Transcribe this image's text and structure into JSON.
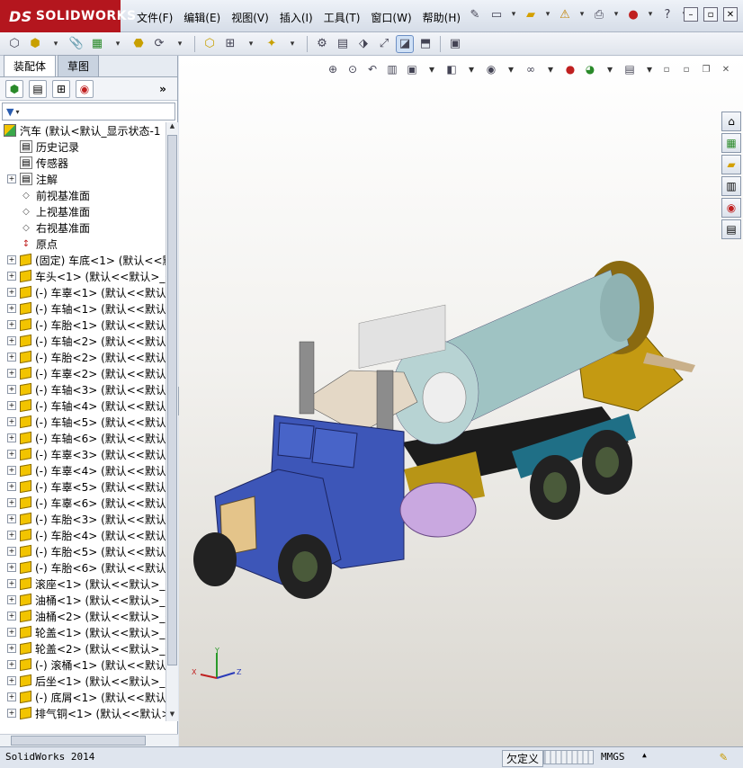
{
  "app": {
    "brand_prefix": "DS",
    "brand": "SOLIDWORKS"
  },
  "menu": [
    {
      "label": "文件(F)"
    },
    {
      "label": "编辑(E)"
    },
    {
      "label": "视图(V)"
    },
    {
      "label": "插入(I)"
    },
    {
      "label": "工具(T)"
    },
    {
      "label": "窗口(W)"
    },
    {
      "label": "帮助(H)"
    }
  ],
  "panel": {
    "tabs": [
      {
        "label": "装配体"
      },
      {
        "label": "草图"
      }
    ],
    "expand_symbol": "»"
  },
  "tree": {
    "root_label": "汽车  (默认<默认_显示状态-1",
    "items": [
      {
        "kind": "folder",
        "icon": "history-icon",
        "label": "历史记录",
        "expandable": false
      },
      {
        "kind": "folder",
        "icon": "sensor-icon",
        "label": "传感器",
        "expandable": false
      },
      {
        "kind": "folder",
        "icon": "annotation-icon",
        "label": "注解",
        "expandable": true
      },
      {
        "kind": "plane",
        "icon": "plane-icon",
        "label": "前视基准面",
        "expandable": false
      },
      {
        "kind": "plane",
        "icon": "plane-icon",
        "label": "上视基准面",
        "expandable": false
      },
      {
        "kind": "plane",
        "icon": "plane-icon",
        "label": "右视基准面",
        "expandable": false
      },
      {
        "kind": "origin",
        "icon": "origin-icon",
        "label": "原点",
        "expandable": false
      },
      {
        "kind": "part",
        "icon": "part-icon",
        "label": "(固定) 车底<1> (默认<<默",
        "expandable": true
      },
      {
        "kind": "part",
        "icon": "part-icon",
        "label": "车头<1> (默认<<默认>_外",
        "expandable": true
      },
      {
        "kind": "part",
        "icon": "part-icon",
        "label": "(-) 车辜<1> (默认<<默认",
        "expandable": true
      },
      {
        "kind": "part",
        "icon": "part-icon",
        "label": "(-) 车轴<1> (默认<<默认",
        "expandable": true
      },
      {
        "kind": "part",
        "icon": "part-icon",
        "label": "(-) 车胎<1> (默认<<默认",
        "expandable": true
      },
      {
        "kind": "part",
        "icon": "part-icon",
        "label": "(-) 车轴<2> (默认<<默认",
        "expandable": true
      },
      {
        "kind": "part",
        "icon": "part-icon",
        "label": "(-) 车胎<2> (默认<<默认",
        "expandable": true
      },
      {
        "kind": "part",
        "icon": "part-icon",
        "label": "(-) 车辜<2> (默认<<默认",
        "expandable": true
      },
      {
        "kind": "part",
        "icon": "part-icon",
        "label": "(-) 车轴<3> (默认<<默认",
        "expandable": true
      },
      {
        "kind": "part",
        "icon": "part-icon",
        "label": "(-) 车轴<4> (默认<<默认",
        "expandable": true
      },
      {
        "kind": "part",
        "icon": "part-icon",
        "label": "(-) 车轴<5> (默认<<默认",
        "expandable": true
      },
      {
        "kind": "part",
        "icon": "part-icon",
        "label": "(-) 车轴<6> (默认<<默认",
        "expandable": true
      },
      {
        "kind": "part",
        "icon": "part-icon",
        "label": "(-) 车辜<3> (默认<<默认",
        "expandable": true
      },
      {
        "kind": "part",
        "icon": "part-icon",
        "label": "(-) 车辜<4> (默认<<默认",
        "expandable": true
      },
      {
        "kind": "part",
        "icon": "part-icon",
        "label": "(-) 车辜<5> (默认<<默认",
        "expandable": true
      },
      {
        "kind": "part",
        "icon": "part-icon",
        "label": "(-) 车辜<6> (默认<<默认",
        "expandable": true
      },
      {
        "kind": "part",
        "icon": "part-icon",
        "label": "(-) 车胎<3> (默认<<默认",
        "expandable": true
      },
      {
        "kind": "part",
        "icon": "part-icon",
        "label": "(-) 车胎<4> (默认<<默认",
        "expandable": true
      },
      {
        "kind": "part",
        "icon": "part-icon",
        "label": "(-) 车胎<5> (默认<<默认",
        "expandable": true
      },
      {
        "kind": "part",
        "icon": "part-icon",
        "label": "(-) 车胎<6> (默认<<默认",
        "expandable": true
      },
      {
        "kind": "part",
        "icon": "part-icon",
        "label": "滚座<1> (默认<<默认>_外",
        "expandable": true
      },
      {
        "kind": "part",
        "icon": "part-icon",
        "label": "油桶<1> (默认<<默认>_外",
        "expandable": true
      },
      {
        "kind": "part",
        "icon": "part-icon",
        "label": "油桶<2> (默认<<默认>_外",
        "expandable": true
      },
      {
        "kind": "part",
        "icon": "part-icon",
        "label": "轮盖<1> (默认<<默认>_外",
        "expandable": true
      },
      {
        "kind": "part",
        "icon": "part-icon",
        "label": "轮盖<2> (默认<<默认>_外",
        "expandable": true
      },
      {
        "kind": "part",
        "icon": "part-icon",
        "label": "(-) 滚桶<1> (默认<<默认",
        "expandable": true
      },
      {
        "kind": "part",
        "icon": "part-icon",
        "label": "后坐<1> (默认<<默认>_外",
        "expandable": true
      },
      {
        "kind": "part",
        "icon": "part-icon",
        "label": "(-) 底屑<1> (默认<<默认",
        "expandable": true
      },
      {
        "kind": "part",
        "icon": "part-icon",
        "label": "排气铜<1> (默认<<默认>_",
        "expandable": true
      }
    ]
  },
  "triad": {
    "x": "X",
    "y": "Y",
    "z": "Z"
  },
  "status": {
    "app_name": "SolidWorks 2014",
    "state": "欠定义",
    "units": "MMGS"
  },
  "colors": {
    "brand_red": "#b4161e",
    "cab_blue": "#3d56b8",
    "drum": "#9fc3c3",
    "frame_yellow": "#c49a12",
    "tank_lavender": "#c9a8e0",
    "fender_teal": "#1f6f86"
  }
}
